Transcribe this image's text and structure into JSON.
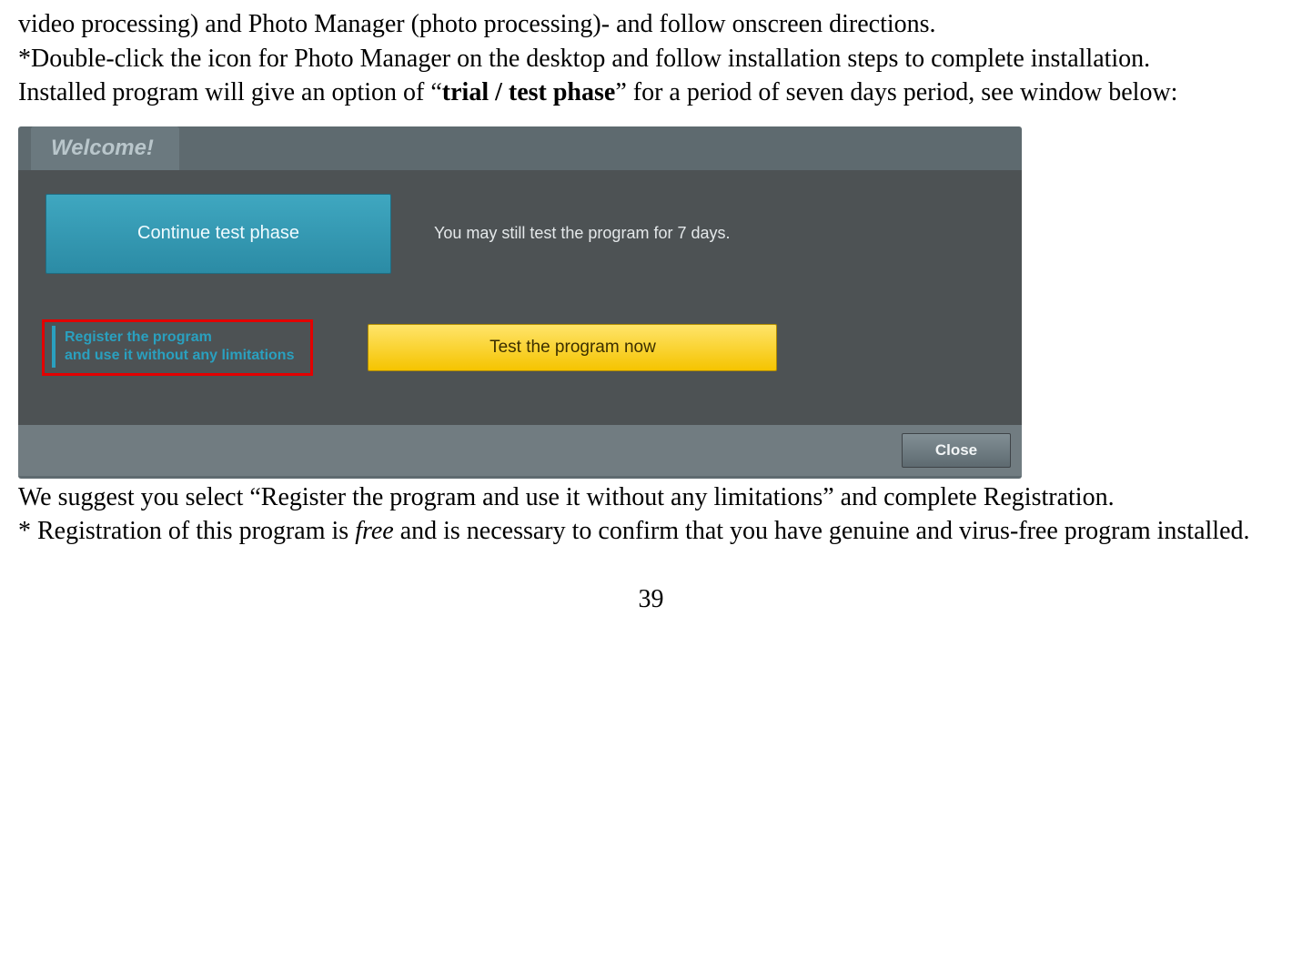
{
  "document": {
    "p1": "video processing) and Photo Manager (photo processing)- and follow onscreen directions.",
    "p2": "*Double-click the icon for Photo Manager on the desktop and follow installation steps to complete installation.",
    "p3_a": "Installed program will give an option of “",
    "p3_bold": "trial / test phase",
    "p3_b": "” for a period of seven days period, see window below:",
    "p4": "We suggest you select “Register the program and use it without any limitations” and complete Registration.",
    "p5_a": "* Registration of this program is ",
    "p5_italic": "free",
    "p5_b": " and is necessary to confirm that you have genuine and virus-free program installed.",
    "page_number": "39"
  },
  "window": {
    "welcome_title": "Welcome!",
    "continue_btn": "Continue test phase",
    "trial_msg": "You may still test the program for 7 days.",
    "register_line1": "Register the program",
    "register_line2": "and use it without any limitations",
    "test_btn": "Test the program now",
    "close_btn": "Close"
  }
}
